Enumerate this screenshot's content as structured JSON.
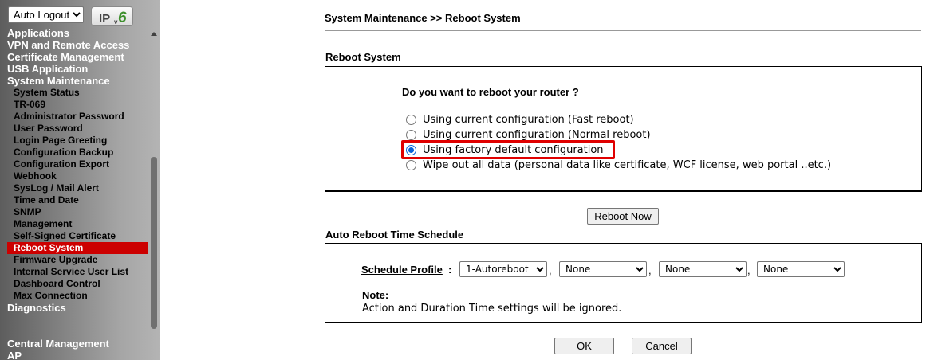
{
  "sidebar": {
    "logout_select": {
      "value": "Auto Logout",
      "options": [
        "Auto Logout"
      ]
    },
    "ipv6_badge": "IPv6",
    "menu": [
      {
        "label": "Applications",
        "level": "top"
      },
      {
        "label": "VPN and Remote Access",
        "level": "top"
      },
      {
        "label": "Certificate Management",
        "level": "top"
      },
      {
        "label": "USB Application",
        "level": "top"
      },
      {
        "label": "System Maintenance",
        "level": "top"
      },
      {
        "label": "System Status",
        "level": "sub"
      },
      {
        "label": "TR-069",
        "level": "sub"
      },
      {
        "label": "Administrator Password",
        "level": "sub"
      },
      {
        "label": "User Password",
        "level": "sub"
      },
      {
        "label": "Login Page Greeting",
        "level": "sub"
      },
      {
        "label": "Configuration Backup",
        "level": "sub"
      },
      {
        "label": "Configuration Export",
        "level": "sub"
      },
      {
        "label": "Webhook",
        "level": "sub"
      },
      {
        "label": "SysLog / Mail Alert",
        "level": "sub"
      },
      {
        "label": "Time and Date",
        "level": "sub"
      },
      {
        "label": "SNMP",
        "level": "sub"
      },
      {
        "label": "Management",
        "level": "sub"
      },
      {
        "label": "Self-Signed Certificate",
        "level": "sub"
      },
      {
        "label": "Reboot System",
        "level": "sub",
        "active": true
      },
      {
        "label": "Firmware Upgrade",
        "level": "sub"
      },
      {
        "label": "Internal Service User List",
        "level": "sub"
      },
      {
        "label": "Dashboard Control",
        "level": "sub"
      },
      {
        "label": "Max Connection",
        "level": "sub"
      },
      {
        "label": "Diagnostics",
        "level": "top"
      },
      {
        "label": "Central Management",
        "level": "top",
        "gap": true
      },
      {
        "label": "AP",
        "level": "top"
      }
    ]
  },
  "main": {
    "breadcrumb": "System Maintenance >> Reboot System",
    "reboot_section": {
      "title": "Reboot System",
      "question": "Do you want to reboot your router ?",
      "options": [
        {
          "label": "Using current configuration (Fast reboot)",
          "checked": false
        },
        {
          "label": "Using current configuration (Normal reboot)",
          "checked": false
        },
        {
          "label": "Using factory default configuration",
          "checked": true
        },
        {
          "label": "Wipe out all data (personal data like certificate, WCF license, web portal ..etc.)",
          "checked": false
        }
      ],
      "reboot_button": "Reboot Now"
    },
    "schedule_section": {
      "title": "Auto Reboot Time Schedule",
      "profile_label": "Schedule Profile",
      "profile_colon": ":",
      "separator": ",",
      "profiles": [
        "1-Autoreboot",
        "None",
        "None",
        "None"
      ],
      "note_title": "Note:",
      "note_text": "Action and Duration Time settings will be ignored."
    },
    "buttons": {
      "ok": "OK",
      "cancel": "Cancel"
    }
  },
  "colors": {
    "active_menu": "#cc0000",
    "highlight": "#e00000",
    "radio_checked": "#0a64d8"
  }
}
